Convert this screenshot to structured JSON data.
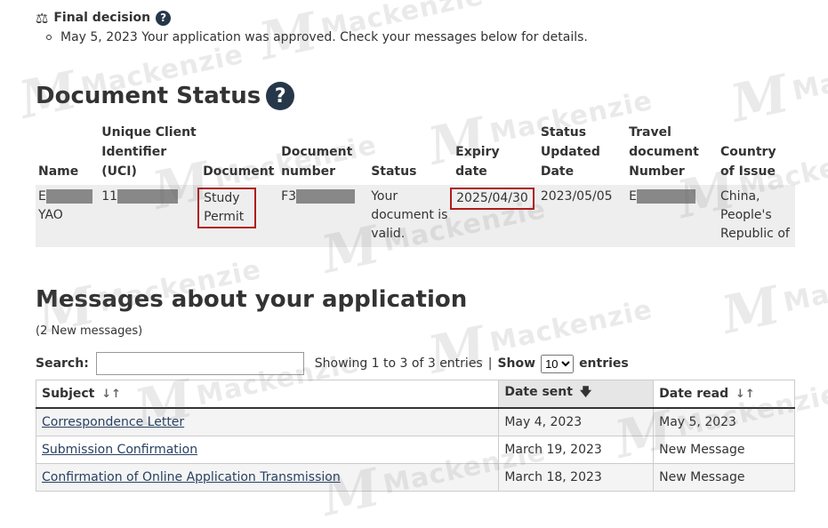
{
  "watermark": {
    "monogram": "M",
    "text": "Mackenzie"
  },
  "final_decision": {
    "heading": "Final decision",
    "items": [
      "May 5, 2023 Your application was approved. Check your messages below for details."
    ]
  },
  "document_status": {
    "title": "Document Status",
    "headers": [
      "Name",
      "Unique Client Identifier (UCI)",
      "Document",
      "Document number",
      "Status",
      "Expiry date",
      "Status Updated Date",
      "Travel document Number",
      "Country of Issue"
    ],
    "row": {
      "name_line1": "E",
      "name_line2": "YAO",
      "uci": "11",
      "document": "Study Permit",
      "document_number": "F3",
      "status": "Your document is valid.",
      "expiry_date": "2025/04/30",
      "status_updated": "2023/05/05",
      "travel_doc": "E",
      "country": "China, People's Republic of"
    }
  },
  "messages": {
    "title": "Messages about your application",
    "new_count": "(2 New messages)",
    "search_label": "Search:",
    "search_value": "",
    "showing_text": "Showing 1 to 3 of 3 entries",
    "separator": "|",
    "show_label": "Show",
    "show_value": "10",
    "entries_label": "entries",
    "columns": [
      "Subject",
      "Date sent",
      "Date read"
    ],
    "rows": [
      {
        "subject": "Correspondence Letter",
        "sent": "May 4, 2023",
        "read": "May 5, 2023"
      },
      {
        "subject": "Submission Confirmation",
        "sent": "March 19, 2023",
        "read": "New Message"
      },
      {
        "subject": "Confirmation of Online Application Transmission",
        "sent": "March 18, 2023",
        "read": "New Message"
      }
    ]
  },
  "icons": {
    "help": "?",
    "scale": "⚖",
    "sort_both": "↓↑",
    "sort_desc": "🡇"
  },
  "colors": {
    "accent_dark": "#26374a",
    "highlight_box": "#b01b1b",
    "link": "#284162"
  }
}
